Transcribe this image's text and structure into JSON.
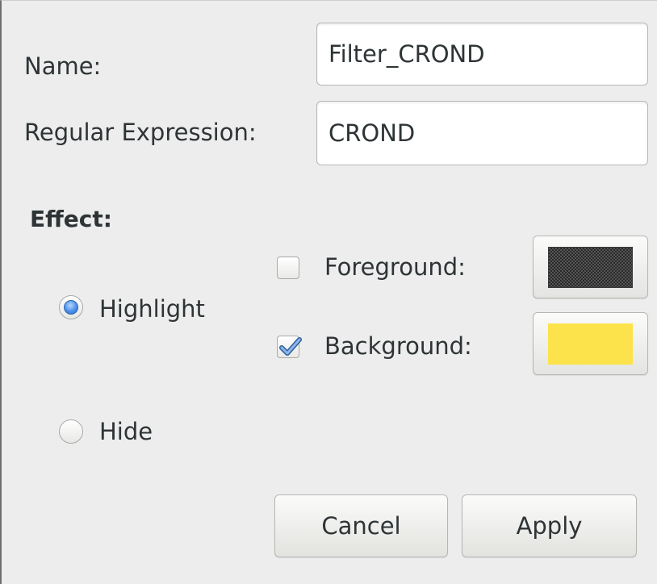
{
  "form": {
    "name_label": "Name:",
    "name_value": "Filter_CROND",
    "regex_label": "Regular Expression:",
    "regex_value": "CROND"
  },
  "effect": {
    "heading": "Effect:",
    "highlight_label": "Highlight",
    "highlight_selected": true,
    "hide_label": "Hide",
    "hide_selected": false,
    "foreground_label": "Foreground:",
    "foreground_checked": false,
    "foreground_color": "#4d4d4d",
    "background_label": "Background:",
    "background_checked": true,
    "background_color": "#fce34b"
  },
  "actions": {
    "cancel_label": "Cancel",
    "apply_label": "Apply"
  }
}
